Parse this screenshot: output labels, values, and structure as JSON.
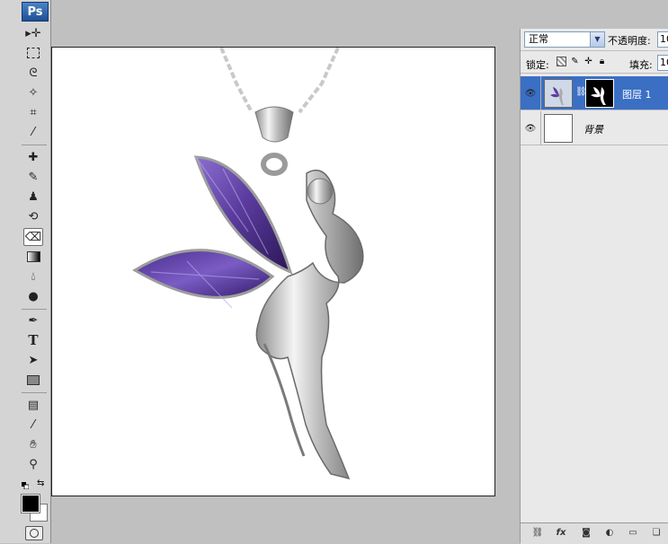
{
  "app": {
    "logo_text": "Ps"
  },
  "tools": {
    "items": [
      {
        "name": "move-tool-icon",
        "glyph": "▸"
      },
      {
        "name": "marquee-tool-icon",
        "glyph": "⬚"
      },
      {
        "name": "lasso-tool-icon",
        "glyph": "ᘓ"
      },
      {
        "name": "magic-wand-tool-icon",
        "glyph": "✧"
      },
      {
        "name": "crop-tool-icon",
        "glyph": "⌗"
      },
      {
        "name": "eyedropper-slice-tool-icon",
        "glyph": "⁄"
      },
      {
        "name": "healing-brush-tool-icon",
        "glyph": "✚"
      },
      {
        "name": "brush-tool-icon",
        "glyph": "✎"
      },
      {
        "name": "clone-stamp-tool-icon",
        "glyph": "♟"
      },
      {
        "name": "history-brush-tool-icon",
        "glyph": "⟲"
      },
      {
        "name": "eraser-tool-icon",
        "glyph": "⌫"
      },
      {
        "name": "gradient-tool-icon",
        "glyph": "▦"
      },
      {
        "name": "blur-tool-icon",
        "glyph": "◖"
      },
      {
        "name": "dodge-tool-icon",
        "glyph": "●"
      },
      {
        "name": "pen-tool-icon",
        "glyph": "✒"
      },
      {
        "name": "type-tool-icon",
        "glyph": "T"
      },
      {
        "name": "path-selection-tool-icon",
        "glyph": "➤"
      },
      {
        "name": "shape-tool-icon",
        "glyph": "▭"
      },
      {
        "name": "notes-tool-icon",
        "glyph": "▤"
      },
      {
        "name": "eyedropper-tool-icon",
        "glyph": "⁄"
      },
      {
        "name": "hand-tool-icon",
        "glyph": "✋"
      },
      {
        "name": "zoom-tool-icon",
        "glyph": "⚲"
      }
    ],
    "active_tool": "eraser-tool-icon",
    "foreground_color": "#000000",
    "background_color": "#ffffff"
  },
  "options": {
    "blend_mode": "正常",
    "opacity_label": "不透明度:",
    "opacity_value": "10",
    "lock_label": "锁定:",
    "fill_label": "填充:",
    "fill_value": "10"
  },
  "layers": [
    {
      "name": "图层 1",
      "visible": true,
      "selected": true,
      "has_mask": true
    },
    {
      "name": "背景",
      "visible": true,
      "selected": false,
      "has_mask": false
    }
  ],
  "colors": {
    "selection": "#3a6fc4",
    "gem": "#5b3c9e"
  }
}
